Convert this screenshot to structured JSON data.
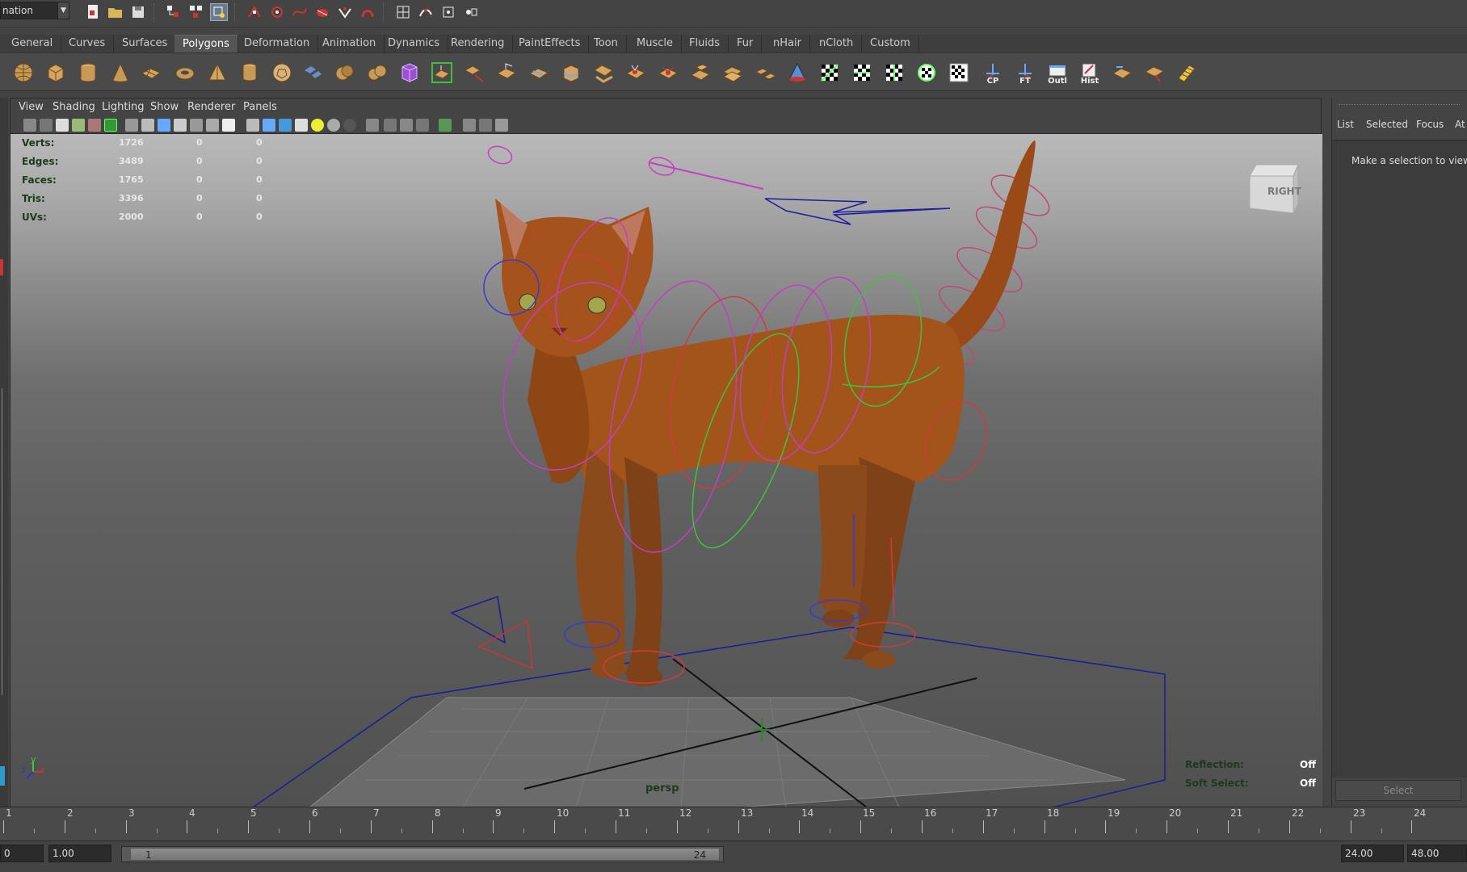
{
  "status": {
    "mode": "nation"
  },
  "shelf_tabs": [
    "General",
    "Curves",
    "Surfaces",
    "Polygons",
    "Deformation",
    "Animation",
    "Dynamics",
    "Rendering",
    "PaintEffects",
    "Toon",
    "Muscle",
    "Fluids",
    "Fur",
    "nHair",
    "nCloth",
    "Custom"
  ],
  "active_shelf_tab": "Polygons",
  "shelf_labels": {
    "cp": "CP",
    "ft": "FT",
    "outl": "Outl",
    "hist": "Hist"
  },
  "panel_menu": [
    "View",
    "Shading",
    "Lighting",
    "Show",
    "Renderer",
    "Panels"
  ],
  "hud": {
    "rows": [
      {
        "label": "Verts:",
        "v1": "1726",
        "v2": "0",
        "v3": "0"
      },
      {
        "label": "Edges:",
        "v1": "3489",
        "v2": "0",
        "v3": "0"
      },
      {
        "label": "Faces:",
        "v1": "1765",
        "v2": "0",
        "v3": "0"
      },
      {
        "label": "Tris:",
        "v1": "3396",
        "v2": "0",
        "v3": "0"
      },
      {
        "label": "UVs:",
        "v1": "2000",
        "v2": "0",
        "v3": "0"
      }
    ],
    "camera": "persp",
    "reflection_label": "Reflection:",
    "reflection_value": "Off",
    "soft_select_label": "Soft Select:",
    "soft_select_value": "Off",
    "viewcube_face": "RIGHT",
    "axis_y": "y",
    "axis_z": "z",
    "axis_x": "x"
  },
  "side": {
    "tabs": [
      "List",
      "Selected",
      "Focus",
      "At"
    ],
    "message": "Make a selection to view a",
    "select_button": "Select"
  },
  "timeline": {
    "ticks": [
      "1",
      "2",
      "3",
      "4",
      "5",
      "6",
      "7",
      "8",
      "9",
      "10",
      "11",
      "12",
      "13",
      "14",
      "15",
      "16",
      "17",
      "18",
      "19",
      "20",
      "21",
      "22",
      "23",
      "24"
    ]
  },
  "range": {
    "current": "0",
    "start": "1.00",
    "range_start": "1",
    "range_end": "24",
    "end": "24.00",
    "max": "48.00"
  }
}
